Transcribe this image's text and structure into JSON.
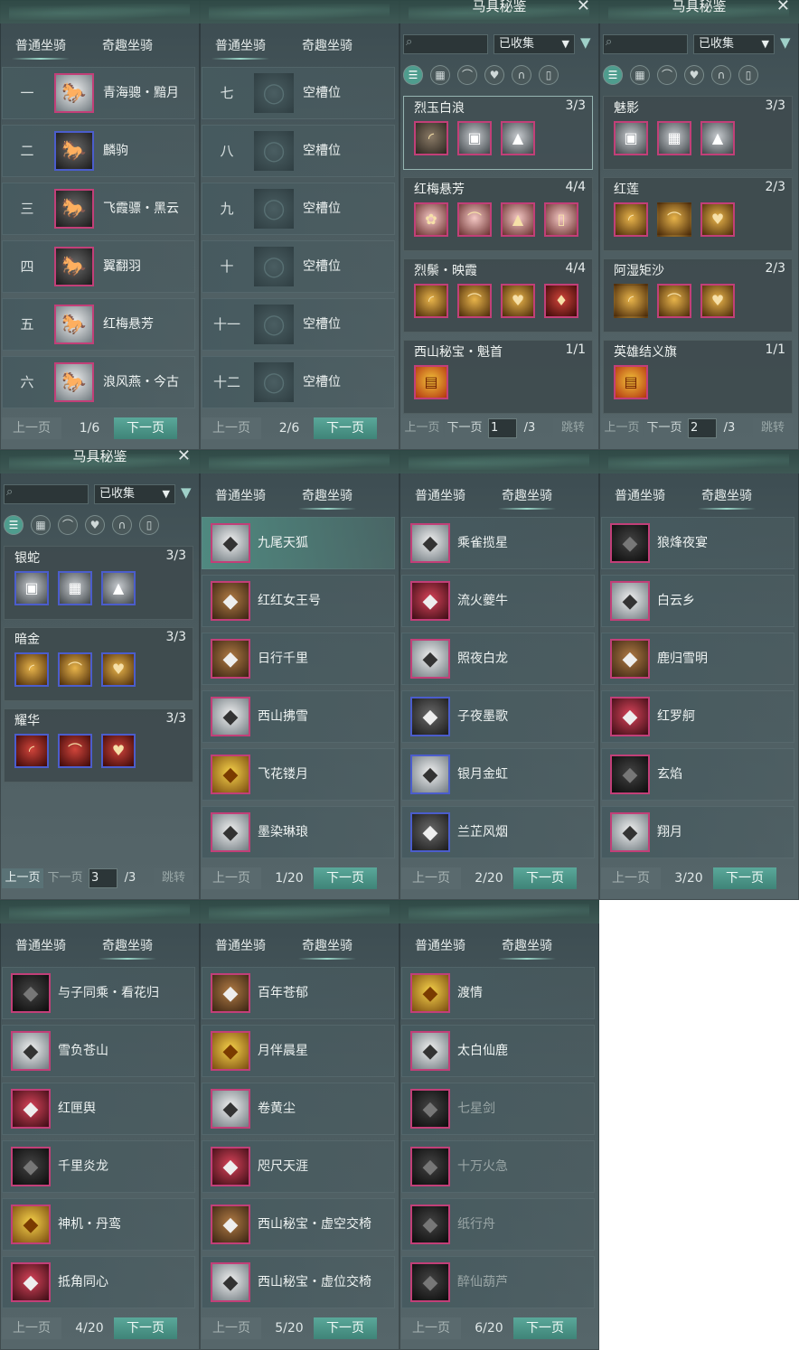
{
  "tabs": {
    "normal": "普通坐骑",
    "fun": "奇趣坐骑"
  },
  "buttons": {
    "prev": "上一页",
    "next": "下一页",
    "jump": "跳转"
  },
  "equip": {
    "title": "马具秘鉴",
    "filter_value": "已收集",
    "search_placeholder": ""
  },
  "normal_pages": [
    {
      "page": "1/6",
      "rows": [
        {
          "num": "一",
          "name": "青海骢・黯月"
        },
        {
          "num": "二",
          "name": "麟驹"
        },
        {
          "num": "三",
          "name": "飞霞骠・黑云"
        },
        {
          "num": "四",
          "name": "翼翻羽"
        },
        {
          "num": "五",
          "name": "红梅悬芳"
        },
        {
          "num": "六",
          "name": "浪风燕・今古"
        }
      ]
    },
    {
      "page": "2/6",
      "rows": [
        {
          "num": "七",
          "name": "空槽位"
        },
        {
          "num": "八",
          "name": "空槽位"
        },
        {
          "num": "九",
          "name": "空槽位"
        },
        {
          "num": "十",
          "name": "空槽位"
        },
        {
          "num": "十一",
          "name": "空槽位"
        },
        {
          "num": "十二",
          "name": "空槽位"
        }
      ]
    }
  ],
  "equip_pages": [
    {
      "page_input": "1",
      "total": "/3",
      "sets": [
        {
          "name": "烈玉白浪",
          "count": "3/3"
        },
        {
          "name": "红梅悬芳",
          "count": "4/4"
        },
        {
          "name": "烈鬃・映霞",
          "count": "4/4"
        },
        {
          "name": "西山秘宝・魁首",
          "count": "1/1"
        }
      ]
    },
    {
      "page_input": "2",
      "total": "/3",
      "sets": [
        {
          "name": "魅影",
          "count": "3/3"
        },
        {
          "name": "红莲",
          "count": "2/3"
        },
        {
          "name": "阿湿矩沙",
          "count": "2/3"
        },
        {
          "name": "英雄结义旗",
          "count": "1/1"
        }
      ]
    },
    {
      "page_input": "3",
      "total": "/3",
      "sets": [
        {
          "name": "银蛇",
          "count": "3/3"
        },
        {
          "name": "暗金",
          "count": "3/3"
        },
        {
          "name": "耀华",
          "count": "3/3"
        }
      ]
    }
  ],
  "fun_pages": [
    {
      "page": "1/20",
      "names": [
        "九尾天狐",
        "红红女王号",
        "日行千里",
        "西山拂雪",
        "飞花镂月",
        "墨染琳琅"
      ]
    },
    {
      "page": "2/20",
      "names": [
        "乘雀揽星",
        "流火夔牛",
        "照夜白龙",
        "子夜墨歌",
        "银月金虹",
        "兰芷风烟"
      ]
    },
    {
      "page": "3/20",
      "names": [
        "狼烽夜宴",
        "白云乡",
        "鹿归雪明",
        "红罗舸",
        "玄焰",
        "翔月"
      ]
    },
    {
      "page": "4/20",
      "names": [
        "与子同乘・看花归",
        "雪负苍山",
        "红匣舆",
        "千里炎龙",
        "神机・丹鸾",
        "抵角同心"
      ]
    },
    {
      "page": "5/20",
      "names": [
        "百年苍郁",
        "月伴晨星",
        "卷黄尘",
        "咫尺天涯",
        "西山秘宝・虚空交椅",
        "西山秘宝・虚位交椅"
      ]
    },
    {
      "page": "6/20",
      "names": [
        "渡情",
        "太白仙鹿",
        "七星剑",
        "十万火急",
        "纸行舟",
        "醉仙葫芦"
      ]
    }
  ],
  "icons": {
    "horse": "horse-icon",
    "empty": "empty-slot-icon",
    "search": "search-icon",
    "filter": "filter-icon",
    "close": "close-icon",
    "list_view": "list-view-icon",
    "grid_view": "grid-view-icon",
    "saddle": "saddle-icon",
    "armor": "armor-icon",
    "horseshoe": "horseshoe-icon",
    "ornament": "ornament-icon"
  },
  "colors": {
    "accent": "#4f9d8e",
    "rare_border": "#c23f78",
    "blue_border": "#4b5dcc"
  }
}
